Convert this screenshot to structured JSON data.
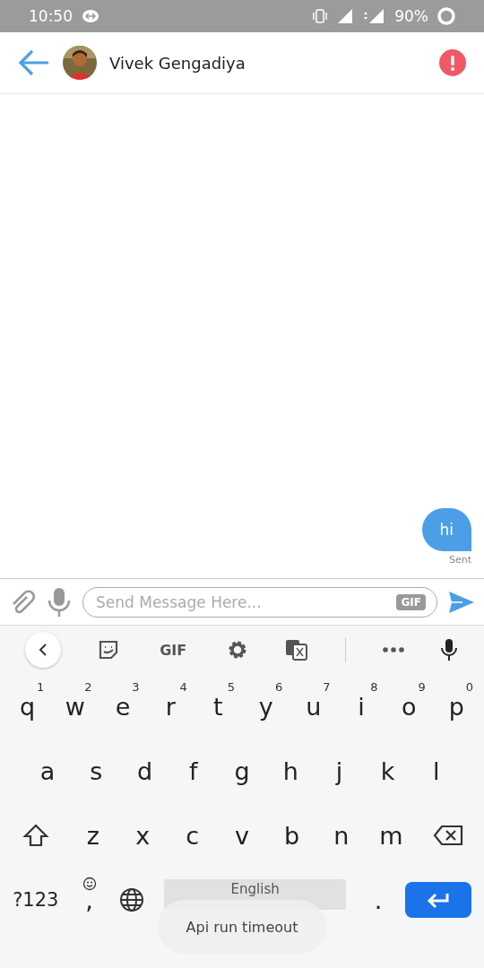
{
  "status_bar": {
    "time": "10:50",
    "battery": "90%"
  },
  "header": {
    "contact_name": "Vivek Gengadiya"
  },
  "messages": [
    {
      "text": "hi",
      "outgoing": true,
      "status": "Sent"
    }
  ],
  "composer": {
    "placeholder": "Send Message Here...",
    "gif_label": "GIF"
  },
  "keyboard_toolbar": {
    "gif_label": "GIF"
  },
  "keyboard": {
    "rows": [
      {
        "keys": [
          {
            "kind": "letter",
            "label": "q",
            "hint": "1"
          },
          {
            "kind": "letter",
            "label": "w",
            "hint": "2"
          },
          {
            "kind": "letter",
            "label": "e",
            "hint": "3"
          },
          {
            "kind": "letter",
            "label": "r",
            "hint": "4"
          },
          {
            "kind": "letter",
            "label": "t",
            "hint": "5"
          },
          {
            "kind": "letter",
            "label": "y",
            "hint": "6"
          },
          {
            "kind": "letter",
            "label": "u",
            "hint": "7"
          },
          {
            "kind": "letter",
            "label": "i",
            "hint": "8"
          },
          {
            "kind": "letter",
            "label": "o",
            "hint": "9"
          },
          {
            "kind": "letter",
            "label": "p",
            "hint": "0"
          }
        ]
      },
      {
        "keys": [
          {
            "kind": "letter",
            "label": "a"
          },
          {
            "kind": "letter",
            "label": "s"
          },
          {
            "kind": "letter",
            "label": "d"
          },
          {
            "kind": "letter",
            "label": "f"
          },
          {
            "kind": "letter",
            "label": "g"
          },
          {
            "kind": "letter",
            "label": "h"
          },
          {
            "kind": "letter",
            "label": "j"
          },
          {
            "kind": "letter",
            "label": "k"
          },
          {
            "kind": "letter",
            "label": "l"
          }
        ]
      },
      {
        "keys": [
          {
            "kind": "shift"
          },
          {
            "kind": "letter",
            "label": "z"
          },
          {
            "kind": "letter",
            "label": "x"
          },
          {
            "kind": "letter",
            "label": "c"
          },
          {
            "kind": "letter",
            "label": "v"
          },
          {
            "kind": "letter",
            "label": "b"
          },
          {
            "kind": "letter",
            "label": "n"
          },
          {
            "kind": "letter",
            "label": "m"
          },
          {
            "kind": "backspace"
          }
        ]
      },
      {
        "keys": [
          {
            "kind": "symbols",
            "label": "?123"
          },
          {
            "kind": "comma",
            "label": ","
          },
          {
            "kind": "globe"
          },
          {
            "kind": "space",
            "label": "English"
          },
          {
            "kind": "letter",
            "label": "."
          },
          {
            "kind": "enter"
          }
        ]
      }
    ]
  },
  "toast": {
    "text": "Api run timeout"
  }
}
